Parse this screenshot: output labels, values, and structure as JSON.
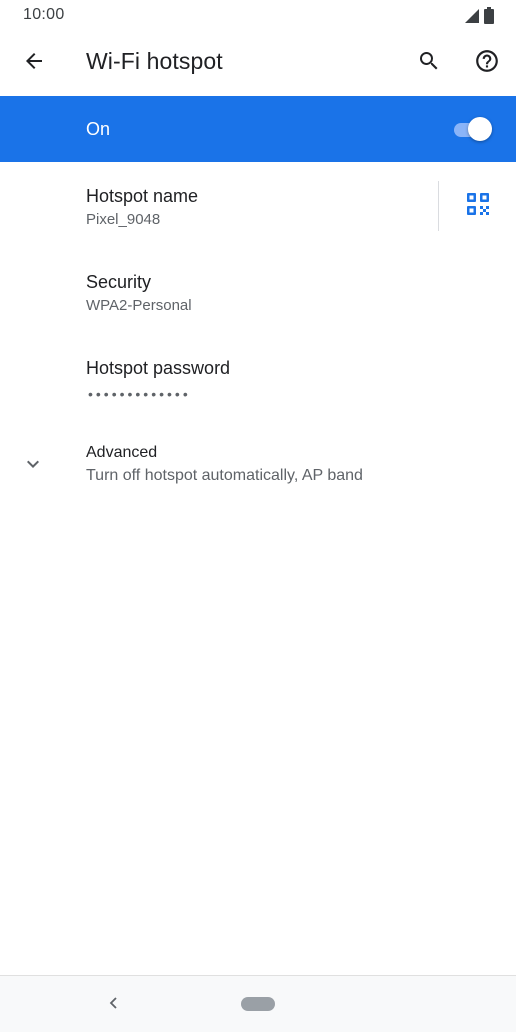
{
  "status_bar": {
    "time": "10:00",
    "icons": [
      "signal-icon",
      "battery-icon"
    ]
  },
  "app_bar": {
    "title": "Wi-Fi hotspot",
    "icons": [
      "back-arrow-icon",
      "search-icon",
      "help-icon"
    ]
  },
  "master_switch": {
    "label": "On",
    "checked": true
  },
  "preferences": {
    "hotspot_name": {
      "title": "Hotspot name",
      "summary": "Pixel_9048",
      "action_icon": "qr-code-icon"
    },
    "security": {
      "title": "Security",
      "summary": "WPA2-Personal"
    },
    "password": {
      "title": "Hotspot password",
      "summary": "•••••••••••••"
    },
    "advanced": {
      "title": "Advanced",
      "summary": "Turn off hotspot automatically, AP band",
      "icon": "chevron-down-icon"
    }
  },
  "nav_bar": {
    "icons": [
      "nav-back-icon",
      "home-pill-icon"
    ]
  },
  "colors": {
    "accent": "#1a73e8",
    "toggle_track": "#8ab4f8",
    "text_primary": "#202124",
    "text_secondary": "#5f6368"
  }
}
